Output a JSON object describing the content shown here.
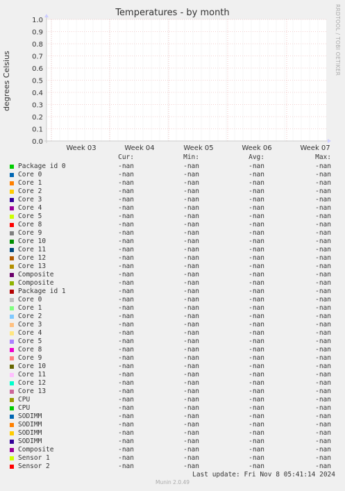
{
  "chart_data": {
    "type": "line",
    "title": "Temperatures - by month",
    "ylabel": "degrees Celsius",
    "xlabel": "",
    "ylim": [
      0.0,
      1.0
    ],
    "y_ticks": [
      "0.0",
      "0.1",
      "0.2",
      "0.3",
      "0.4",
      "0.5",
      "0.6",
      "0.7",
      "0.8",
      "0.9",
      "1.0"
    ],
    "x_ticks": [
      "Week 03",
      "Week 04",
      "Week 05",
      "Week 06",
      "Week 07"
    ],
    "grid": true,
    "series_values": "no data (all -nan)"
  },
  "side_label": "RRDTOOL / TOBI OETIKER",
  "legend": {
    "headers": [
      "Cur:",
      "Min:",
      "Avg:",
      "Max:"
    ],
    "rows": [
      {
        "name": "Package id 0",
        "color": "#00cc00",
        "cur": "-nan",
        "min": "-nan",
        "avg": "-nan",
        "max": "-nan"
      },
      {
        "name": "Core 0",
        "color": "#0066b3",
        "cur": "-nan",
        "min": "-nan",
        "avg": "-nan",
        "max": "-nan"
      },
      {
        "name": "Core 1",
        "color": "#ff8000",
        "cur": "-nan",
        "min": "-nan",
        "avg": "-nan",
        "max": "-nan"
      },
      {
        "name": "Core 2",
        "color": "#ffcc00",
        "cur": "-nan",
        "min": "-nan",
        "avg": "-nan",
        "max": "-nan"
      },
      {
        "name": "Core 3",
        "color": "#330099",
        "cur": "-nan",
        "min": "-nan",
        "avg": "-nan",
        "max": "-nan"
      },
      {
        "name": "Core 4",
        "color": "#990099",
        "cur": "-nan",
        "min": "-nan",
        "avg": "-nan",
        "max": "-nan"
      },
      {
        "name": "Core 5",
        "color": "#ccff00",
        "cur": "-nan",
        "min": "-nan",
        "avg": "-nan",
        "max": "-nan"
      },
      {
        "name": "Core 8",
        "color": "#ff0000",
        "cur": "-nan",
        "min": "-nan",
        "avg": "-nan",
        "max": "-nan"
      },
      {
        "name": "Core 9",
        "color": "#808080",
        "cur": "-nan",
        "min": "-nan",
        "avg": "-nan",
        "max": "-nan"
      },
      {
        "name": "Core 10",
        "color": "#008f00",
        "cur": "-nan",
        "min": "-nan",
        "avg": "-nan",
        "max": "-nan"
      },
      {
        "name": "Core 11",
        "color": "#00487d",
        "cur": "-nan",
        "min": "-nan",
        "avg": "-nan",
        "max": "-nan"
      },
      {
        "name": "Core 12",
        "color": "#b35a00",
        "cur": "-nan",
        "min": "-nan",
        "avg": "-nan",
        "max": "-nan"
      },
      {
        "name": "Core 13",
        "color": "#b38f00",
        "cur": "-nan",
        "min": "-nan",
        "avg": "-nan",
        "max": "-nan"
      },
      {
        "name": "Composite",
        "color": "#6b006b",
        "cur": "-nan",
        "min": "-nan",
        "avg": "-nan",
        "max": "-nan"
      },
      {
        "name": "Composite",
        "color": "#8fb300",
        "cur": "-nan",
        "min": "-nan",
        "avg": "-nan",
        "max": "-nan"
      },
      {
        "name": "Package id 1",
        "color": "#b30000",
        "cur": "-nan",
        "min": "-nan",
        "avg": "-nan",
        "max": "-nan"
      },
      {
        "name": "Core 0",
        "color": "#bebebe",
        "cur": "-nan",
        "min": "-nan",
        "avg": "-nan",
        "max": "-nan"
      },
      {
        "name": "Core 1",
        "color": "#80ff80",
        "cur": "-nan",
        "min": "-nan",
        "avg": "-nan",
        "max": "-nan"
      },
      {
        "name": "Core 2",
        "color": "#80c9ff",
        "cur": "-nan",
        "min": "-nan",
        "avg": "-nan",
        "max": "-nan"
      },
      {
        "name": "Core 3",
        "color": "#ffc080",
        "cur": "-nan",
        "min": "-nan",
        "avg": "-nan",
        "max": "-nan"
      },
      {
        "name": "Core 4",
        "color": "#ffe680",
        "cur": "-nan",
        "min": "-nan",
        "avg": "-nan",
        "max": "-nan"
      },
      {
        "name": "Core 5",
        "color": "#aa80ff",
        "cur": "-nan",
        "min": "-nan",
        "avg": "-nan",
        "max": "-nan"
      },
      {
        "name": "Core 8",
        "color": "#ee00cc",
        "cur": "-nan",
        "min": "-nan",
        "avg": "-nan",
        "max": "-nan"
      },
      {
        "name": "Core 9",
        "color": "#ff8080",
        "cur": "-nan",
        "min": "-nan",
        "avg": "-nan",
        "max": "-nan"
      },
      {
        "name": "Core 10",
        "color": "#666600",
        "cur": "-nan",
        "min": "-nan",
        "avg": "-nan",
        "max": "-nan"
      },
      {
        "name": "Core 11",
        "color": "#ffbfff",
        "cur": "-nan",
        "min": "-nan",
        "avg": "-nan",
        "max": "-nan"
      },
      {
        "name": "Core 12",
        "color": "#00ffcc",
        "cur": "-nan",
        "min": "-nan",
        "avg": "-nan",
        "max": "-nan"
      },
      {
        "name": "Core 13",
        "color": "#cc6699",
        "cur": "-nan",
        "min": "-nan",
        "avg": "-nan",
        "max": "-nan"
      },
      {
        "name": "CPU",
        "color": "#999900",
        "cur": "-nan",
        "min": "-nan",
        "avg": "-nan",
        "max": "-nan"
      },
      {
        "name": "CPU",
        "color": "#00cc00",
        "cur": "-nan",
        "min": "-nan",
        "avg": "-nan",
        "max": "-nan"
      },
      {
        "name": "SODIMM",
        "color": "#0066b3",
        "cur": "-nan",
        "min": "-nan",
        "avg": "-nan",
        "max": "-nan"
      },
      {
        "name": "SODIMM",
        "color": "#ff8000",
        "cur": "-nan",
        "min": "-nan",
        "avg": "-nan",
        "max": "-nan"
      },
      {
        "name": "SODIMM",
        "color": "#ffcc00",
        "cur": "-nan",
        "min": "-nan",
        "avg": "-nan",
        "max": "-nan"
      },
      {
        "name": "SODIMM",
        "color": "#330099",
        "cur": "-nan",
        "min": "-nan",
        "avg": "-nan",
        "max": "-nan"
      },
      {
        "name": "Composite",
        "color": "#990099",
        "cur": "-nan",
        "min": "-nan",
        "avg": "-nan",
        "max": "-nan"
      },
      {
        "name": "Sensor 1",
        "color": "#ccff00",
        "cur": "-nan",
        "min": "-nan",
        "avg": "-nan",
        "max": "-nan"
      },
      {
        "name": "Sensor 2",
        "color": "#ff0000",
        "cur": "-nan",
        "min": "-nan",
        "avg": "-nan",
        "max": "-nan"
      }
    ]
  },
  "last_update": "Last update: Fri Nov  8 05:41:14 2024",
  "footer": "Munin 2.0.49",
  "colors": {
    "background": "#f0f0f0",
    "plot_background": "#ffffff",
    "grid_major": "#e8a0a0",
    "axis": "#cccccc"
  }
}
